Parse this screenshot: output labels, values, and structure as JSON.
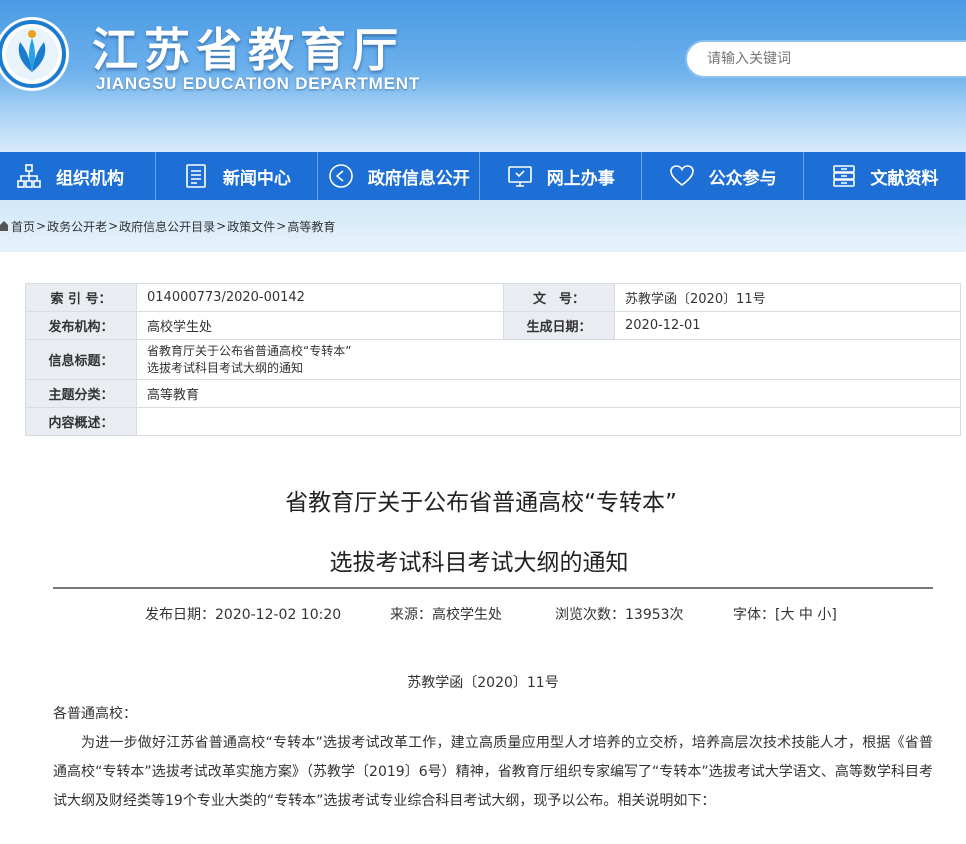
{
  "header": {
    "logo_cn": "江苏省教育厅",
    "logo_en": "JIANGSU EDUCATION DEPARTMENT",
    "search_placeholder": "请输入关键词"
  },
  "nav": {
    "items": [
      {
        "label": "组织机构",
        "icon": "org-chart-icon"
      },
      {
        "label": "新闻中心",
        "icon": "document-icon"
      },
      {
        "label": "政府信息公开",
        "icon": "play-circle-icon"
      },
      {
        "label": "网上办事",
        "icon": "monitor-icon"
      },
      {
        "label": "公众参与",
        "icon": "heart-icon"
      },
      {
        "label": "文献资料",
        "icon": "archive-icon"
      }
    ]
  },
  "breadcrumb": {
    "items": [
      "首页",
      "政务公开老",
      "政府信息公开目录",
      "政策文件",
      "高等教育"
    ],
    "separator": ">"
  },
  "info": {
    "index_label": "索 引 号：",
    "index_value": "014000773/2020-00142",
    "docno_label": "文　号：",
    "docno_value": "苏教学函〔2020〕11号",
    "publisher_label": "发布机构：",
    "publisher_value": "高校学生处",
    "date_label": "生成日期：",
    "date_value": "2020-12-01",
    "title_label": "信息标题：",
    "title_line1": "省教育厅关于公布省普通高校“专转本”",
    "title_line2": "选拔考试科目考试大纲的通知",
    "category_label": "主题分类：",
    "category_value": "高等教育",
    "summary_label": "内容概述：",
    "summary_value": ""
  },
  "article": {
    "title_line1": "省教育厅关于公布省普通高校“专转本”",
    "title_line2": "选拔考试科目考试大纲的通知",
    "publish_date": "发布日期：2020-12-02 10:20",
    "source": "来源：高校学生处",
    "views": "浏览次数：13953次",
    "font_size_label": "字体：[大 中 小]",
    "doc_number": "苏教学函〔2020〕11号",
    "salutation": "各普通高校：",
    "paragraph1": "为进一步做好江苏省普通高校“专转本”选拔考试改革工作，建立高质量应用型人才培养的立交桥，培养高层次技术技能人才，根据《省普通高校“专转本”选拔考试改革实施方案》（苏教学〔2019〕6号）精神，省教育厅组织专家编写了“专转本”选拔考试大学语文、高等数学科目考试大纲及财经类等19个专业大类的“专转本”选拔考试专业综合科目考试大纲，现予以公布。相关说明如下："
  },
  "colors": {
    "nav_bg": "#1d6fd6",
    "header_top": "#4a9ae4",
    "breadcrumb_bg": "#d2e8f8",
    "table_label_bg": "#e9edf2"
  }
}
